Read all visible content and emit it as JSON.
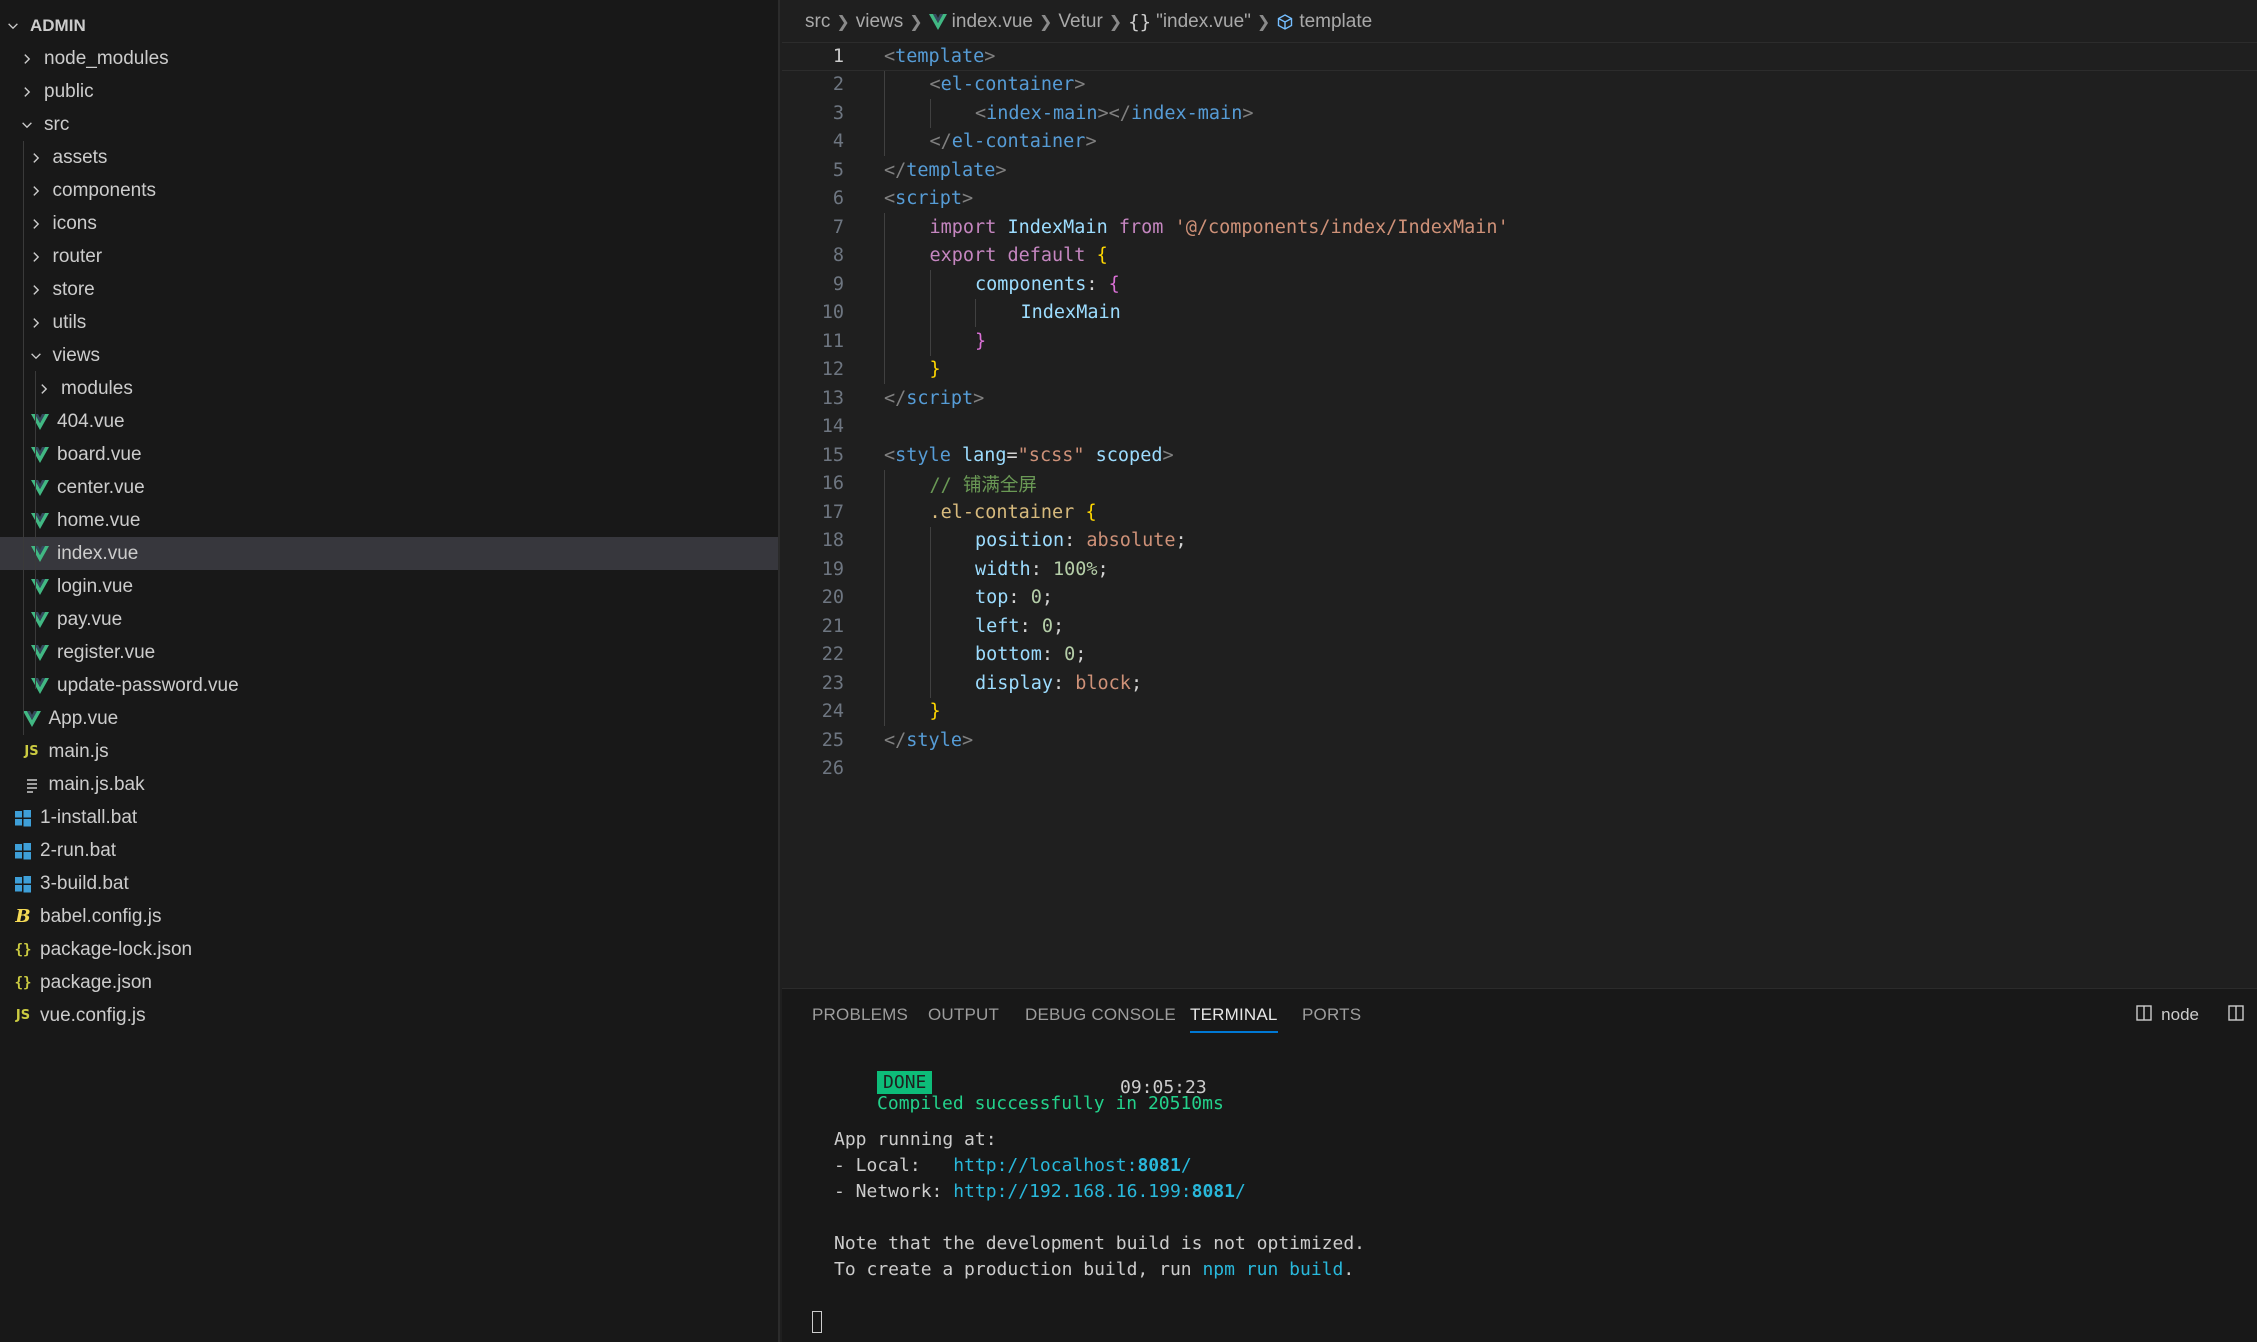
{
  "explorer": {
    "root": "ADMIN",
    "items": [
      {
        "label": "node_modules",
        "type": "folder",
        "open": false,
        "depth": 1
      },
      {
        "label": "public",
        "type": "folder",
        "open": false,
        "depth": 1
      },
      {
        "label": "src",
        "type": "folder",
        "open": true,
        "depth": 1
      },
      {
        "label": "assets",
        "type": "folder",
        "open": false,
        "depth": 2
      },
      {
        "label": "components",
        "type": "folder",
        "open": false,
        "depth": 2
      },
      {
        "label": "icons",
        "type": "folder",
        "open": false,
        "depth": 2
      },
      {
        "label": "router",
        "type": "folder",
        "open": false,
        "depth": 2
      },
      {
        "label": "store",
        "type": "folder",
        "open": false,
        "depth": 2
      },
      {
        "label": "utils",
        "type": "folder",
        "open": false,
        "depth": 2
      },
      {
        "label": "views",
        "type": "folder",
        "open": true,
        "depth": 2
      },
      {
        "label": "modules",
        "type": "folder",
        "open": false,
        "depth": 3
      },
      {
        "label": "404.vue",
        "type": "vue",
        "depth": 3
      },
      {
        "label": "board.vue",
        "type": "vue",
        "depth": 3
      },
      {
        "label": "center.vue",
        "type": "vue",
        "depth": 3
      },
      {
        "label": "home.vue",
        "type": "vue",
        "depth": 3
      },
      {
        "label": "index.vue",
        "type": "vue",
        "depth": 3,
        "active": true
      },
      {
        "label": "login.vue",
        "type": "vue",
        "depth": 3
      },
      {
        "label": "pay.vue",
        "type": "vue",
        "depth": 3
      },
      {
        "label": "register.vue",
        "type": "vue",
        "depth": 3
      },
      {
        "label": "update-password.vue",
        "type": "vue",
        "depth": 3
      },
      {
        "label": "App.vue",
        "type": "vue",
        "depth": 2
      },
      {
        "label": "main.js",
        "type": "js",
        "depth": 2
      },
      {
        "label": "main.js.bak",
        "type": "text",
        "depth": 2
      },
      {
        "label": "1-install.bat",
        "type": "bat",
        "depth": 1
      },
      {
        "label": "2-run.bat",
        "type": "bat",
        "depth": 1
      },
      {
        "label": "3-build.bat",
        "type": "bat",
        "depth": 1
      },
      {
        "label": "babel.config.js",
        "type": "babel",
        "depth": 1
      },
      {
        "label": "package-lock.json",
        "type": "json",
        "depth": 1
      },
      {
        "label": "package.json",
        "type": "json",
        "depth": 1
      },
      {
        "label": "vue.config.js",
        "type": "js",
        "depth": 1
      }
    ]
  },
  "breadcrumb": {
    "parts": [
      "src",
      "views",
      "index.vue",
      "Vetur",
      "\"index.vue\"",
      "template"
    ]
  },
  "editor": {
    "current_line": 1,
    "lines": [
      {
        "n": "1",
        "indent": 0,
        "tokens": [
          [
            "br",
            "<"
          ],
          [
            "tag",
            "template"
          ],
          [
            "br",
            ">"
          ]
        ]
      },
      {
        "n": "2",
        "indent": 1,
        "tokens": [
          [
            "br",
            "<"
          ],
          [
            "tag",
            "el-container"
          ],
          [
            "br",
            ">"
          ]
        ]
      },
      {
        "n": "3",
        "indent": 2,
        "tokens": [
          [
            "br",
            "<"
          ],
          [
            "tag",
            "index-main"
          ],
          [
            "br",
            "></"
          ],
          [
            "tag",
            "index-main"
          ],
          [
            "br",
            ">"
          ]
        ]
      },
      {
        "n": "4",
        "indent": 1,
        "tokens": [
          [
            "br",
            "</"
          ],
          [
            "tag",
            "el-container"
          ],
          [
            "br",
            ">"
          ]
        ]
      },
      {
        "n": "5",
        "indent": 0,
        "tokens": [
          [
            "br",
            "</"
          ],
          [
            "tag",
            "template"
          ],
          [
            "br",
            ">"
          ]
        ]
      },
      {
        "n": "6",
        "indent": 0,
        "tokens": [
          [
            "br",
            "<"
          ],
          [
            "tag",
            "script"
          ],
          [
            "br",
            ">"
          ]
        ]
      },
      {
        "n": "7",
        "indent": 1,
        "tokens": [
          [
            "kw",
            "import "
          ],
          [
            "id",
            "IndexMain "
          ],
          [
            "kw",
            "from "
          ],
          [
            "str",
            "'@/components/index/IndexMain'"
          ]
        ]
      },
      {
        "n": "8",
        "indent": 1,
        "tokens": [
          [
            "kw",
            "export default "
          ],
          [
            "yb",
            "{"
          ]
        ]
      },
      {
        "n": "9",
        "indent": 2,
        "tokens": [
          [
            "id",
            "components"
          ],
          [
            "plain",
            ": "
          ],
          [
            "pb",
            "{"
          ]
        ]
      },
      {
        "n": "10",
        "indent": 3,
        "tokens": [
          [
            "id",
            "IndexMain"
          ]
        ]
      },
      {
        "n": "11",
        "indent": 2,
        "tokens": [
          [
            "pb",
            "}"
          ]
        ]
      },
      {
        "n": "12",
        "indent": 1,
        "tokens": [
          [
            "yb",
            "}"
          ]
        ]
      },
      {
        "n": "13",
        "indent": 0,
        "tokens": [
          [
            "br",
            "</"
          ],
          [
            "tag",
            "script"
          ],
          [
            "br",
            ">"
          ]
        ]
      },
      {
        "n": "14",
        "indent": 0,
        "tokens": []
      },
      {
        "n": "15",
        "indent": 0,
        "tokens": [
          [
            "br",
            "<"
          ],
          [
            "tag",
            "style "
          ],
          [
            "id",
            "lang"
          ],
          [
            "plain",
            "="
          ],
          [
            "str",
            "\"scss\" "
          ],
          [
            "id",
            "scoped"
          ],
          [
            "br",
            ">"
          ]
        ]
      },
      {
        "n": "16",
        "indent": 1,
        "tokens": [
          [
            "cm",
            "// 铺满全屏"
          ]
        ]
      },
      {
        "n": "17",
        "indent": 1,
        "tokens": [
          [
            "cls",
            ".el-container "
          ],
          [
            "yb",
            "{"
          ]
        ]
      },
      {
        "n": "18",
        "indent": 2,
        "tokens": [
          [
            "id",
            "position"
          ],
          [
            "plain",
            ": "
          ],
          [
            "str",
            "absolute"
          ],
          [
            "plain",
            ";"
          ]
        ]
      },
      {
        "n": "19",
        "indent": 2,
        "tokens": [
          [
            "id",
            "width"
          ],
          [
            "plain",
            ": "
          ],
          [
            "num",
            "100%"
          ],
          [
            "plain",
            ";"
          ]
        ]
      },
      {
        "n": "20",
        "indent": 2,
        "tokens": [
          [
            "id",
            "top"
          ],
          [
            "plain",
            ": "
          ],
          [
            "num",
            "0"
          ],
          [
            "plain",
            ";"
          ]
        ]
      },
      {
        "n": "21",
        "indent": 2,
        "tokens": [
          [
            "id",
            "left"
          ],
          [
            "plain",
            ": "
          ],
          [
            "num",
            "0"
          ],
          [
            "plain",
            ";"
          ]
        ]
      },
      {
        "n": "22",
        "indent": 2,
        "tokens": [
          [
            "id",
            "bottom"
          ],
          [
            "plain",
            ": "
          ],
          [
            "num",
            "0"
          ],
          [
            "plain",
            ";"
          ]
        ]
      },
      {
        "n": "23",
        "indent": 2,
        "tokens": [
          [
            "id",
            "display"
          ],
          [
            "plain",
            ": "
          ],
          [
            "str",
            "block"
          ],
          [
            "plain",
            ";"
          ]
        ]
      },
      {
        "n": "24",
        "indent": 1,
        "tokens": [
          [
            "yb",
            "}"
          ]
        ]
      },
      {
        "n": "25",
        "indent": 0,
        "tokens": [
          [
            "br",
            "</"
          ],
          [
            "tag",
            "style"
          ],
          [
            "br",
            ">"
          ]
        ]
      },
      {
        "n": "26",
        "indent": 0,
        "tokens": []
      }
    ]
  },
  "panel": {
    "tabs": [
      "PROBLEMS",
      "OUTPUT",
      "DEBUG CONSOLE",
      "TERMINAL",
      "PORTS"
    ],
    "active_tab": "TERMINAL",
    "terminal_name": "node"
  },
  "terminal": {
    "done_badge": "DONE",
    "compiled": "Compiled successfully in 20510ms",
    "time": "09:05:23",
    "app_running": "App running at:",
    "local_label": "- Local:   ",
    "local_url_pre": "http://localhost:",
    "local_port": "8081",
    "local_url_post": "/",
    "network_label": "- Network: ",
    "network_url_pre": "http://192.168.16.199:",
    "network_port": "8081",
    "network_url_post": "/",
    "note1": "Note that the development build is not optimized.",
    "note2_pre": "To create a production build, run ",
    "note2_cmd": "npm run build",
    "note2_post": "."
  },
  "colors": {
    "accent": "#0078d4",
    "vue_green": "#41b883",
    "js_yellow": "#cbcb41",
    "done_green": "#0dbc79"
  }
}
